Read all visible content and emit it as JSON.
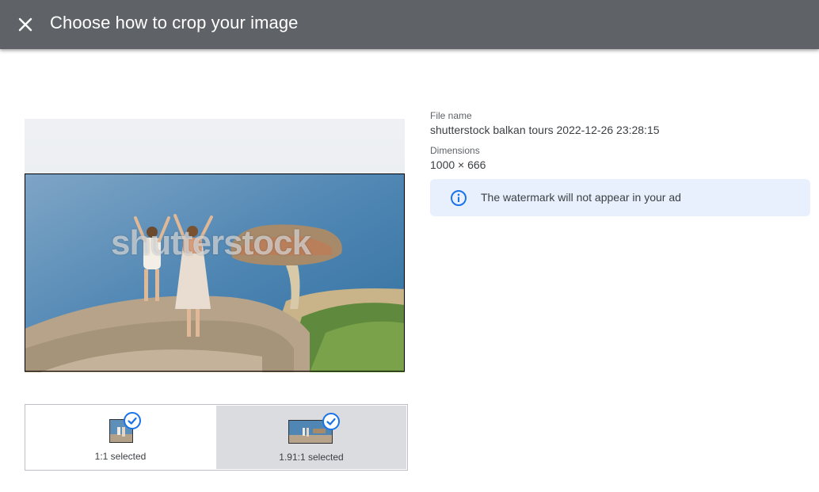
{
  "header": {
    "title": "Choose how to crop your image",
    "close_icon": "close-icon"
  },
  "preview": {
    "watermark_text": "shutterstock"
  },
  "file_info": {
    "file_name_label": "File name",
    "file_name": "shutterstock balkan tours 2022-12-26 23:28:15",
    "dimensions_label": "Dimensions",
    "dimensions": "1000 × 666"
  },
  "notice": {
    "icon": "info-icon",
    "text": "The watermark will not appear in your ad",
    "color": "#e8f0fe"
  },
  "aspect_ratios": [
    {
      "label": "1:1 selected",
      "selected": true
    },
    {
      "label": "1.91:1 selected",
      "selected": true
    }
  ],
  "colors": {
    "header_bg": "#5f6368",
    "accent": "#1a73e8",
    "active_option_bg": "#dadce0"
  }
}
